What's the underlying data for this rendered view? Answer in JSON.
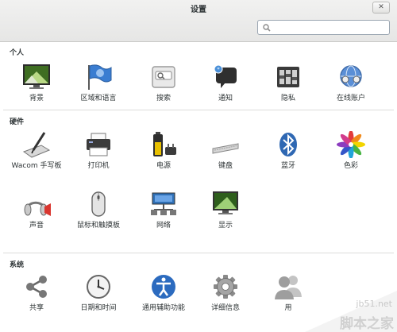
{
  "window": {
    "title": "设置",
    "close": "✕"
  },
  "search": {
    "value": "",
    "placeholder": ""
  },
  "sections": [
    {
      "title": "个人",
      "items": [
        {
          "label": "背景",
          "icon": "background-icon"
        },
        {
          "label": "区域和语言",
          "icon": "region-flag-icon"
        },
        {
          "label": "搜索",
          "icon": "search-icon"
        },
        {
          "label": "通知",
          "icon": "notification-icon"
        },
        {
          "label": "隐私",
          "icon": "privacy-icon"
        },
        {
          "label": "在线账户",
          "icon": "online-accounts-icon"
        }
      ]
    },
    {
      "title": "硬件",
      "items": [
        {
          "label": "Wacom 手写板",
          "icon": "wacom-tablet-icon"
        },
        {
          "label": "打印机",
          "icon": "printer-icon"
        },
        {
          "label": "电源",
          "icon": "battery-icon"
        },
        {
          "label": "键盘",
          "icon": "keyboard-icon"
        },
        {
          "label": "蓝牙",
          "icon": "bluetooth-icon"
        },
        {
          "label": "色彩",
          "icon": "color-icon"
        },
        {
          "label": "声音",
          "icon": "sound-icon"
        },
        {
          "label": "鼠标和触摸板",
          "icon": "mouse-icon"
        },
        {
          "label": "网络",
          "icon": "network-icon"
        },
        {
          "label": "显示",
          "icon": "display-icon"
        }
      ]
    },
    {
      "title": "系统",
      "items": [
        {
          "label": "共享",
          "icon": "share-icon"
        },
        {
          "label": "日期和时间",
          "icon": "clock-icon"
        },
        {
          "label": "通用辅助功能",
          "icon": "accessibility-icon"
        },
        {
          "label": "详细信息",
          "icon": "gear-icon"
        },
        {
          "label": "用",
          "icon": "users-icon"
        }
      ]
    }
  ],
  "watermark": {
    "url": "jb51.net",
    "brand": "脚本之家"
  }
}
